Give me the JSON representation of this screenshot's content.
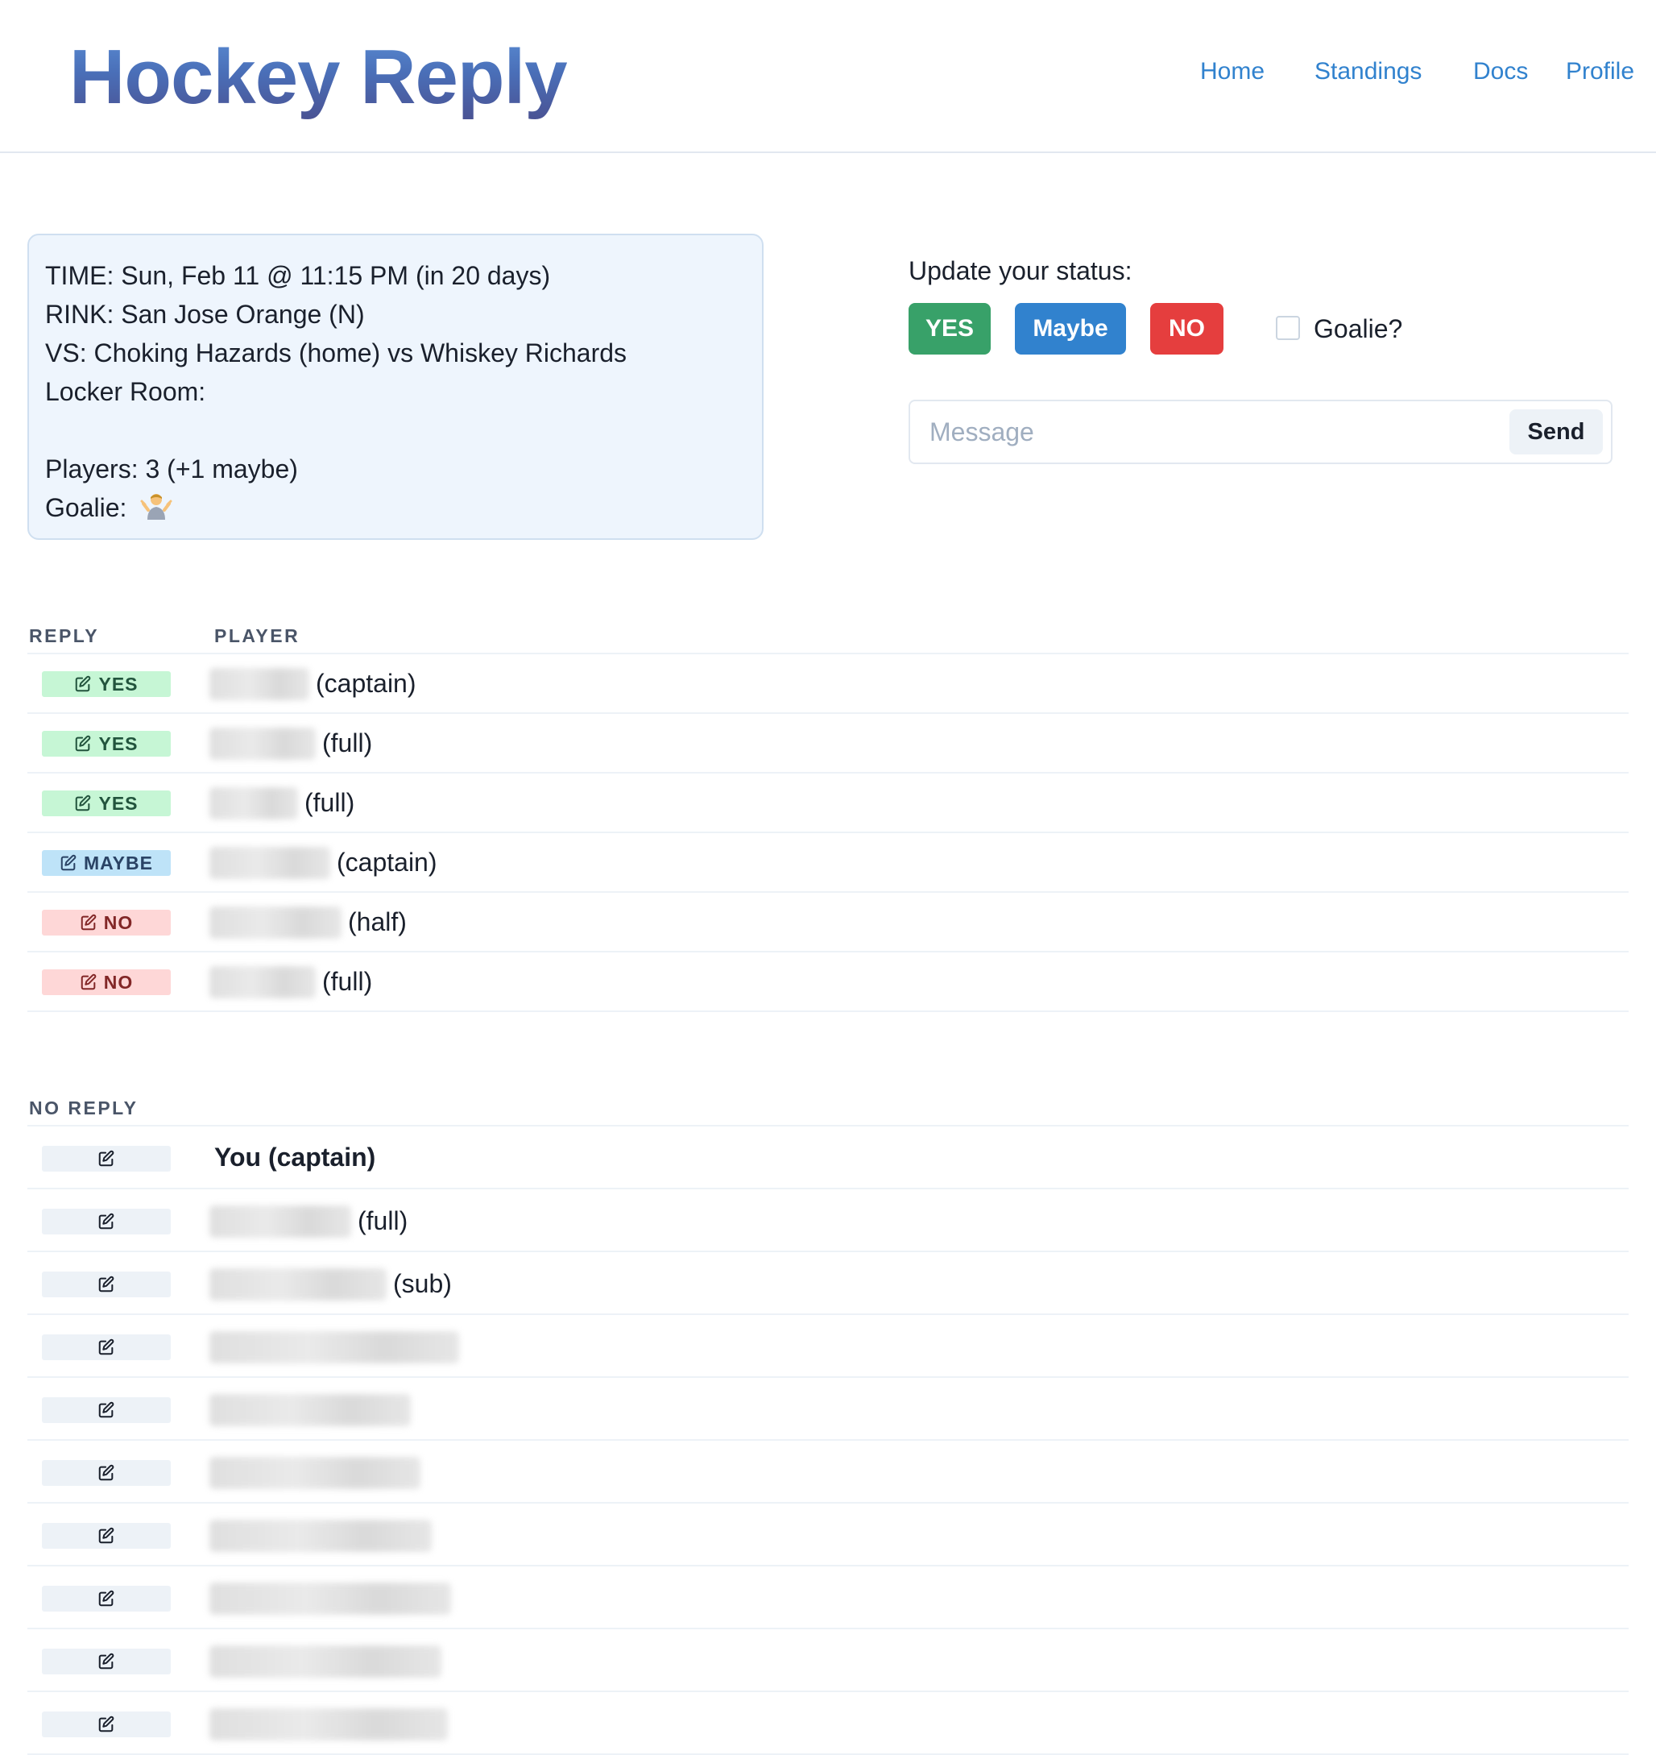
{
  "header": {
    "brand": "Hockey Reply",
    "nav": {
      "home": "Home",
      "standings": "Standings",
      "docs": "Docs",
      "profile": "Profile"
    }
  },
  "game": {
    "time": "TIME: Sun, Feb 11 @ 11:15 PM (in 20 days)",
    "rink": "RINK: San Jose Orange (N)",
    "vs": "VS: Choking Hazards (home) vs Whiskey Richards",
    "locker_room": "Locker Room:",
    "players": "Players: 3 (+1 maybe)",
    "goalie_label": "Goalie:",
    "goalie_icon": "person-shrugging-emoji"
  },
  "status_panel": {
    "label": "Update your status:",
    "yes_label": "YES",
    "maybe_label": "Maybe",
    "no_label": "NO",
    "goalie_checkbox_label": "Goalie?",
    "goalie_checked": false,
    "message_placeholder": "Message",
    "message_value": "",
    "send_label": "Send"
  },
  "reply_table": {
    "col_reply": "REPLY",
    "col_player": "PLAYER",
    "rows": [
      {
        "status": "YES",
        "role": "(captain)"
      },
      {
        "status": "YES",
        "role": "(full)"
      },
      {
        "status": "YES",
        "role": "(full)"
      },
      {
        "status": "MAYBE",
        "role": "(captain)"
      },
      {
        "status": "NO",
        "role": "(half)"
      },
      {
        "status": "NO",
        "role": "(full)"
      }
    ]
  },
  "no_reply_table": {
    "heading": "NO REPLY",
    "you_label": "You (captain)",
    "rows": [
      {
        "role": "(full)"
      },
      {
        "role": "(sub)"
      }
    ]
  },
  "colors": {
    "yes": "#38a169",
    "maybe": "#3182ce",
    "no": "#e53e3e",
    "link": "#3182ce"
  }
}
